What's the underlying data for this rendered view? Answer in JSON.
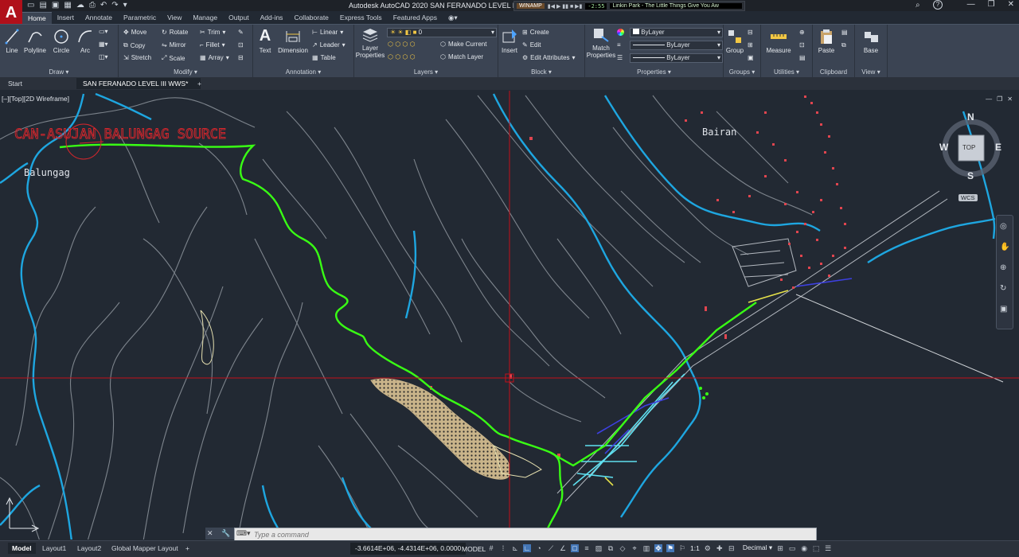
{
  "app": {
    "logo": "A",
    "window_title": "Autodesk AutoCAD 2020   SAN FERANADO LEVEL III WWS...",
    "window_controls": [
      "—",
      "❐",
      "✕"
    ]
  },
  "winamp": {
    "label": "WINAMP",
    "time": "-2:55",
    "song": "Linkin Park - The Little Things Give You Aw"
  },
  "ribbon_tabs": [
    "Home",
    "Insert",
    "Annotate",
    "Parametric",
    "View",
    "Manage",
    "Output",
    "Add-ins",
    "Collaborate",
    "Express Tools",
    "Featured Apps"
  ],
  "active_tab": "Home",
  "ribbon": {
    "draw": {
      "title": "Draw",
      "tools": [
        "Line",
        "Polyline",
        "Circle",
        "Arc"
      ]
    },
    "modify": {
      "title": "Modify",
      "tools": [
        "Move",
        "Rotate",
        "Trim",
        "Copy",
        "Mirror",
        "Fillet",
        "Stretch",
        "Scale",
        "Array"
      ]
    },
    "annotation": {
      "title": "Annotation",
      "tools": [
        "Text",
        "Dimension",
        "Linear",
        "Leader",
        "Table"
      ]
    },
    "layers": {
      "title": "Layers",
      "layer_properties": "Layer Properties",
      "current_layer": "0",
      "make_current": "Make Current",
      "match_layer": "Match Layer"
    },
    "block": {
      "title": "Block",
      "insert": "Insert",
      "create": "Create",
      "edit": "Edit",
      "edit_attributes": "Edit Attributes"
    },
    "properties": {
      "title": "Properties",
      "match": "Match Properties",
      "color": "ByLayer",
      "linetype": "ByLayer",
      "lineweight": "ByLayer"
    },
    "groups": {
      "title": "Groups",
      "group": "Group"
    },
    "utilities": {
      "title": "Utilities",
      "measure": "Measure"
    },
    "clipboard": {
      "title": "Clipboard",
      "paste": "Paste"
    },
    "view": {
      "title": "View",
      "base": "Base"
    }
  },
  "doc_tabs": [
    "Start",
    "SAN FERANADO LEVEL III WWS*"
  ],
  "viewport": {
    "label": "[–][Top][2D Wireframe]",
    "viewcube": {
      "n": "N",
      "s": "S",
      "e": "E",
      "w": "W",
      "face": "TOP",
      "wcs": "WCS"
    }
  },
  "map_labels": {
    "source": "CAN-ASUJAN BALUNGAG SOURCE",
    "balungag": "Balungag",
    "bairan": "Bairan"
  },
  "command": {
    "placeholder": "Type a command"
  },
  "layout_tabs": [
    "Model",
    "Layout1",
    "Layout2",
    "Global Mapper Layout"
  ],
  "status": {
    "coords": "-3.6614E+06, -4.4314E+06, 0.0000",
    "model": "MODEL",
    "scale": "1:1",
    "units": "Decimal"
  },
  "colors": {
    "background": "#222933",
    "ribbon": "#3b4453",
    "pipeline": "#39ff14",
    "rivers": "#1ea6e0",
    "roads": "#9aa0a6",
    "buildings": "#e0454f",
    "crosshair": "#c4101a",
    "source_text": "#d8262c"
  }
}
